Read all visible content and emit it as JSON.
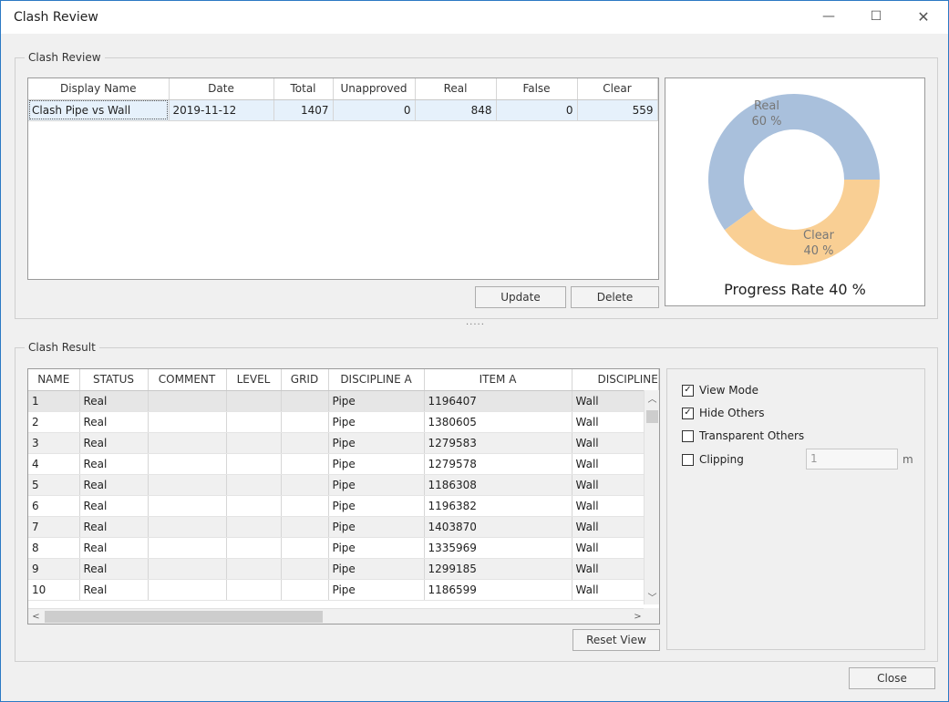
{
  "window": {
    "title": "Clash Review",
    "min_glyph": "—",
    "max_glyph": "☐",
    "close_glyph": "✕"
  },
  "review": {
    "group_title": "Clash Review",
    "columns": [
      "Display Name",
      "Date",
      "Total",
      "Unapproved",
      "Real",
      "False",
      "Clear"
    ],
    "rows": [
      {
        "name": "Clash Pipe vs Wall",
        "date": "2019-11-12",
        "total": "1407",
        "unapproved": "0",
        "real": "848",
        "false": "0",
        "clear": "559"
      }
    ],
    "update_label": "Update",
    "delete_label": "Delete"
  },
  "chart_data": {
    "type": "pie",
    "donut": true,
    "slices": [
      {
        "label": "Real",
        "percent_label": "60 %",
        "value": 60,
        "color": "#a9c0dc"
      },
      {
        "label": "Clear",
        "percent_label": "40 %",
        "value": 40,
        "color": "#f9cf94"
      }
    ],
    "caption": "Progress Rate 40 %"
  },
  "splitter": "·····",
  "result": {
    "group_title": "Clash Result",
    "columns": [
      "NAME",
      "STATUS",
      "COMMENT",
      "LEVEL",
      "GRID",
      "DISCIPLINE A",
      "ITEM A",
      "DISCIPLINE"
    ],
    "rows": [
      {
        "name": "1",
        "status": "Real",
        "comment": "",
        "level": "",
        "grid": "",
        "disc_a": "Pipe",
        "item_a": "1196407",
        "disc_b": "Wall"
      },
      {
        "name": "2",
        "status": "Real",
        "comment": "",
        "level": "",
        "grid": "",
        "disc_a": "Pipe",
        "item_a": "1380605",
        "disc_b": "Wall"
      },
      {
        "name": "3",
        "status": "Real",
        "comment": "",
        "level": "",
        "grid": "",
        "disc_a": "Pipe",
        "item_a": "1279583",
        "disc_b": "Wall"
      },
      {
        "name": "4",
        "status": "Real",
        "comment": "",
        "level": "",
        "grid": "",
        "disc_a": "Pipe",
        "item_a": "1279578",
        "disc_b": "Wall"
      },
      {
        "name": "5",
        "status": "Real",
        "comment": "",
        "level": "",
        "grid": "",
        "disc_a": "Pipe",
        "item_a": "1186308",
        "disc_b": "Wall"
      },
      {
        "name": "6",
        "status": "Real",
        "comment": "",
        "level": "",
        "grid": "",
        "disc_a": "Pipe",
        "item_a": "1196382",
        "disc_b": "Wall"
      },
      {
        "name": "7",
        "status": "Real",
        "comment": "",
        "level": "",
        "grid": "",
        "disc_a": "Pipe",
        "item_a": "1403870",
        "disc_b": "Wall"
      },
      {
        "name": "8",
        "status": "Real",
        "comment": "",
        "level": "",
        "grid": "",
        "disc_a": "Pipe",
        "item_a": "1335969",
        "disc_b": "Wall"
      },
      {
        "name": "9",
        "status": "Real",
        "comment": "",
        "level": "",
        "grid": "",
        "disc_a": "Pipe",
        "item_a": "1299185",
        "disc_b": "Wall"
      },
      {
        "name": "10",
        "status": "Real",
        "comment": "",
        "level": "",
        "grid": "",
        "disc_a": "Pipe",
        "item_a": "1186599",
        "disc_b": "Wall"
      }
    ],
    "reset_view_label": "Reset View"
  },
  "options": {
    "view_mode": {
      "label": "View Mode",
      "checked": true
    },
    "hide_others": {
      "label": "Hide Others",
      "checked": true
    },
    "transparent_others": {
      "label": "Transparent Others",
      "checked": false
    },
    "clipping": {
      "label": "Clipping",
      "checked": false,
      "value": "1",
      "unit": "m"
    },
    "check_glyph": "✓"
  },
  "footer": {
    "close_label": "Close"
  }
}
